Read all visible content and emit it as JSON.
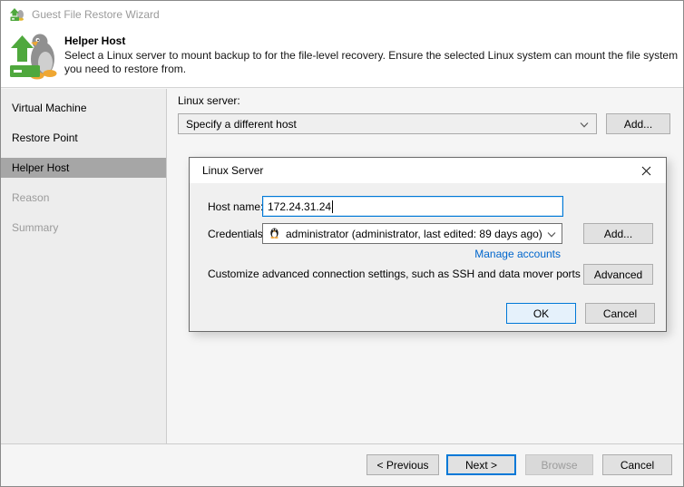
{
  "window": {
    "title": "Guest File Restore Wizard"
  },
  "header": {
    "title": "Helper Host",
    "description": "Select a Linux server to mount backup to for the file-level recovery. Ensure the selected Linux system can mount the file system you need to restore from."
  },
  "sidebar": {
    "items": [
      {
        "label": "Virtual Machine",
        "state": "normal"
      },
      {
        "label": "Restore Point",
        "state": "normal"
      },
      {
        "label": "Helper Host",
        "state": "selected"
      },
      {
        "label": "Reason",
        "state": "disabled"
      },
      {
        "label": "Summary",
        "state": "disabled"
      }
    ]
  },
  "content": {
    "linux_server_label": "Linux server:",
    "linux_server_value": "Specify a different host",
    "add_button": "Add..."
  },
  "dialog": {
    "title": "Linux Server",
    "host_name_label": "Host name:",
    "host_name_value": "172.24.31.24",
    "credentials_label": "Credentials:",
    "credentials_value": "administrator (administrator, last edited: 89 days ago)",
    "add_button": "Add...",
    "manage_accounts_link": "Manage accounts",
    "advanced_text": "Customize advanced connection settings, such as SSH and data mover ports",
    "advanced_button": "Advanced",
    "ok_button": "OK",
    "cancel_button": "Cancel"
  },
  "footer": {
    "previous_button": "< Previous",
    "next_button": "Next >",
    "browse_button": "Browse",
    "cancel_button": "Cancel"
  },
  "colors": {
    "accent_blue": "#0078d7",
    "link_blue": "#0066cc",
    "veeam_green": "#4fa83d",
    "sidebar_selected": "#a6a6a6"
  },
  "icons": {
    "app_icon": "restore-arrow-with-tux",
    "step_icon": "tux-penguin-with-green-restore-arrow",
    "credentials_icon": "tux-penguin",
    "chevron": "v",
    "close": "x"
  }
}
